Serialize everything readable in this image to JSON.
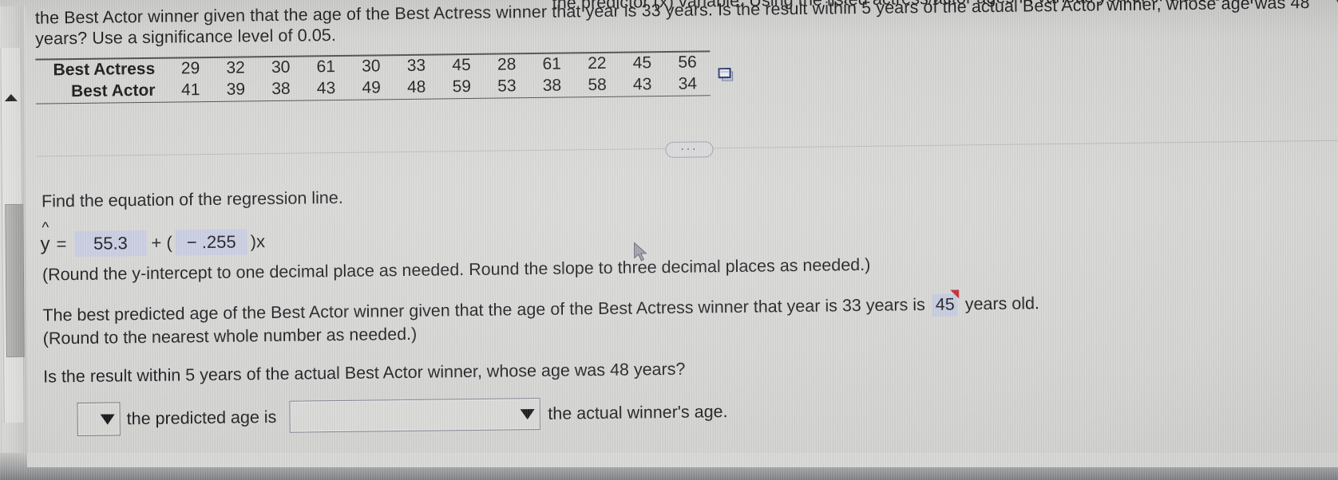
{
  "question": {
    "line_top": "the predictor (x) variable. Using the listed actress/actor ages in various years, find the best predicted age of",
    "line_1": "the Best Actor winner given that the age of the Best Actress winner that year is 33 years. Is the result within 5 years of the actual Best Actor winner, whose age was 48",
    "line_2": "years? Use a significance level of 0.05."
  },
  "table": {
    "row_labels": [
      "Best Actress",
      "Best Actor"
    ],
    "best_actress": [
      29,
      32,
      30,
      61,
      30,
      33,
      45,
      28,
      61,
      22,
      45,
      56
    ],
    "best_actor": [
      41,
      39,
      38,
      43,
      49,
      48,
      59,
      53,
      38,
      58,
      43,
      34
    ],
    "copy_icon": "copy-to-spreadsheet-icon"
  },
  "separator": {
    "ellipsis": "···"
  },
  "answers": {
    "prompt_regression": "Find the equation of the regression line.",
    "yhat_symbol": "y",
    "hat": "^",
    "equals": "=",
    "intercept": "55.3",
    "plus_open": "+ (",
    "slope": "− .255",
    "close_x": ")x",
    "rounding_note": "(Round the y-intercept to one decimal place as needed. Round the slope to three decimal places as needed.)",
    "predicted_sentence_before": "The best predicted age of the Best Actor winner given that the age of the Best Actress winner that year is 33 years is",
    "predicted_value": "45",
    "predicted_sentence_after": "years old.",
    "rounding_note_2": "(Round to the nearest whole number as needed.)",
    "within_question": "Is the result within 5 years of the actual Best Actor winner, whose age was 48 years?"
  },
  "dropdowns": {
    "first_value": "",
    "middle_label": "the predicted age is",
    "second_value": "",
    "trailing_label": "the actual winner's age.",
    "caret_icon": "chevron-down-icon"
  },
  "scrollbar": {
    "up_arrow_icon": "scroll-up-arrow-icon",
    "thumb": "scrollbar-thumb"
  },
  "cursor": {
    "icon": "mouse-pointer-icon"
  },
  "colors": {
    "answer_box": "#c6cbe0",
    "flag_red": "#c0202a",
    "text": "#16161a",
    "screen_bg": "#d4d4d2"
  }
}
